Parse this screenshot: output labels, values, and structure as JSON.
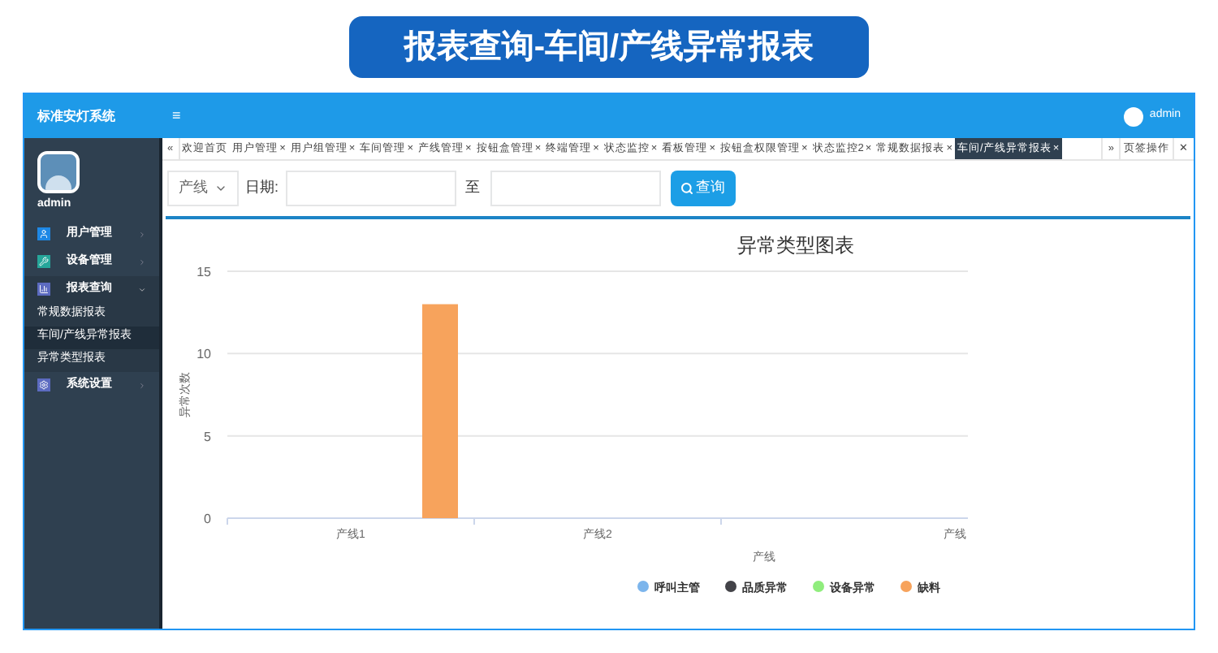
{
  "banner": {
    "title": "报表查询-车间/产线异常报表"
  },
  "app": {
    "title": "标准安灯系统",
    "menu_toggle": "≡",
    "user": "admin"
  },
  "sidebar": {
    "user": "admin",
    "items": [
      {
        "label": "用户管理",
        "expanded": false
      },
      {
        "label": "设备管理",
        "expanded": false
      },
      {
        "label": "报表查询",
        "expanded": true,
        "children": [
          {
            "label": "常规数据报表",
            "selected": false
          },
          {
            "label": "车间/产线异常报表",
            "selected": true
          },
          {
            "label": "异常类型报表",
            "selected": false
          }
        ]
      },
      {
        "label": "系统设置",
        "expanded": false
      }
    ]
  },
  "tabs": {
    "prev": "«",
    "next": "»",
    "actions": "页签操作",
    "close_all": "✕",
    "items": [
      {
        "label": "欢迎首页",
        "selected": false
      },
      {
        "label": "用户管理",
        "close": "×",
        "selected": false
      },
      {
        "label": "用户组管理",
        "close": "×",
        "selected": false
      },
      {
        "label": "车间管理",
        "close": "×",
        "selected": false
      },
      {
        "label": "产线管理",
        "close": "×",
        "selected": false
      },
      {
        "label": "按钮盒管理",
        "close": "×",
        "selected": false
      },
      {
        "label": "终端管理",
        "close": "×",
        "selected": false
      },
      {
        "label": "状态监控",
        "close": "×",
        "selected": false
      },
      {
        "label": "看板管理",
        "close": "×",
        "selected": false
      },
      {
        "label": "按钮盒权限管理",
        "close": "×",
        "selected": false
      },
      {
        "label": "状态监控2",
        "close": "×",
        "selected": false
      },
      {
        "label": "常规数据报表",
        "close": "×",
        "selected": false
      },
      {
        "label": "车间/产线异常报表",
        "close": "×",
        "selected": true
      }
    ]
  },
  "filter": {
    "type_select": "产线",
    "date_label": "日期:",
    "to_label": "至",
    "query_button": "查询"
  },
  "chart": {
    "chart_data": {
      "type": "bar",
      "title": "异常类型图表",
      "xlabel": "产线",
      "ylabel": "异常次数",
      "categories": [
        "产线1",
        "产线2",
        "产线"
      ],
      "ylim": [
        0,
        15
      ],
      "yticks": [
        0,
        5,
        10,
        15
      ],
      "series": [
        {
          "name": "呼叫主管",
          "color": "#7cb5ec",
          "values": [
            0,
            0,
            0
          ]
        },
        {
          "name": "品质异常",
          "color": "#434348",
          "values": [
            0,
            0,
            0
          ]
        },
        {
          "name": "设备异常",
          "color": "#90ed7d",
          "values": [
            0,
            0,
            0
          ]
        },
        {
          "name": "缺料",
          "color": "#f7a35c",
          "values": [
            13,
            0,
            0
          ]
        }
      ]
    }
  }
}
